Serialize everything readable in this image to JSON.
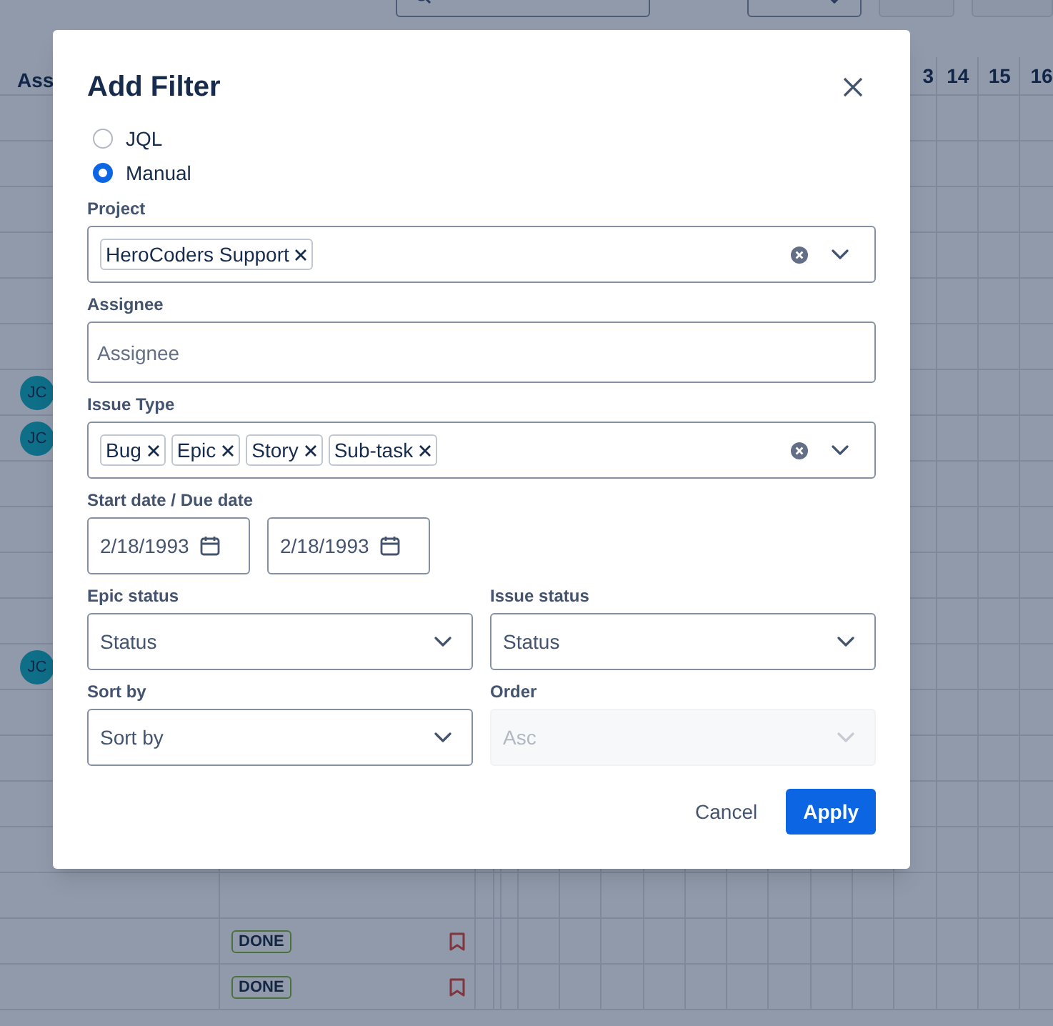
{
  "table": {
    "first_column": "Ass",
    "day_headers": [
      {
        "label": "3",
        "kind": "partial"
      },
      {
        "label": "14",
        "kind": "full"
      },
      {
        "label": "15",
        "kind": "full"
      },
      {
        "label": "16",
        "kind": "full"
      }
    ],
    "rows": [
      {},
      {},
      {},
      {},
      {},
      {},
      {
        "assignee": "JC"
      },
      {
        "assignee": "JC"
      },
      {},
      {},
      {},
      {},
      {
        "assignee": "JC"
      },
      {},
      {},
      {},
      {},
      {},
      {
        "status": "DONE",
        "flagged": true
      },
      {
        "status": "DONE",
        "flagged": true
      }
    ]
  },
  "dialog": {
    "title": "Add Filter",
    "mode_options": [
      {
        "label": "JQL",
        "selected": false
      },
      {
        "label": "Manual",
        "selected": true
      }
    ],
    "fields": [
      {
        "kind": "multi",
        "label": "Project",
        "tags": [
          "HeroCoders Support"
        ]
      },
      {
        "kind": "text",
        "label": "Assignee",
        "placeholder": "Assignee"
      },
      {
        "kind": "multi",
        "label": "Issue Type",
        "tags": [
          "Bug",
          "Epic",
          "Story",
          "Sub-task"
        ]
      },
      {
        "kind": "dates",
        "label": "Start date / Due date",
        "values": [
          "2/18/1993",
          "2/18/1993"
        ]
      },
      {
        "kind": "pair",
        "items": [
          {
            "label": "Epic status",
            "placeholder": "Status",
            "disabled": false
          },
          {
            "label": "Issue status",
            "placeholder": "Status",
            "disabled": false
          }
        ]
      },
      {
        "kind": "pair",
        "items": [
          {
            "label": "Sort by",
            "placeholder": "Sort by",
            "disabled": false
          },
          {
            "label": "Order",
            "value": "Asc",
            "disabled": true
          }
        ]
      }
    ],
    "buttons": [
      {
        "label": "Cancel",
        "kind": "subtle"
      },
      {
        "label": "Apply",
        "kind": "primary"
      }
    ]
  }
}
